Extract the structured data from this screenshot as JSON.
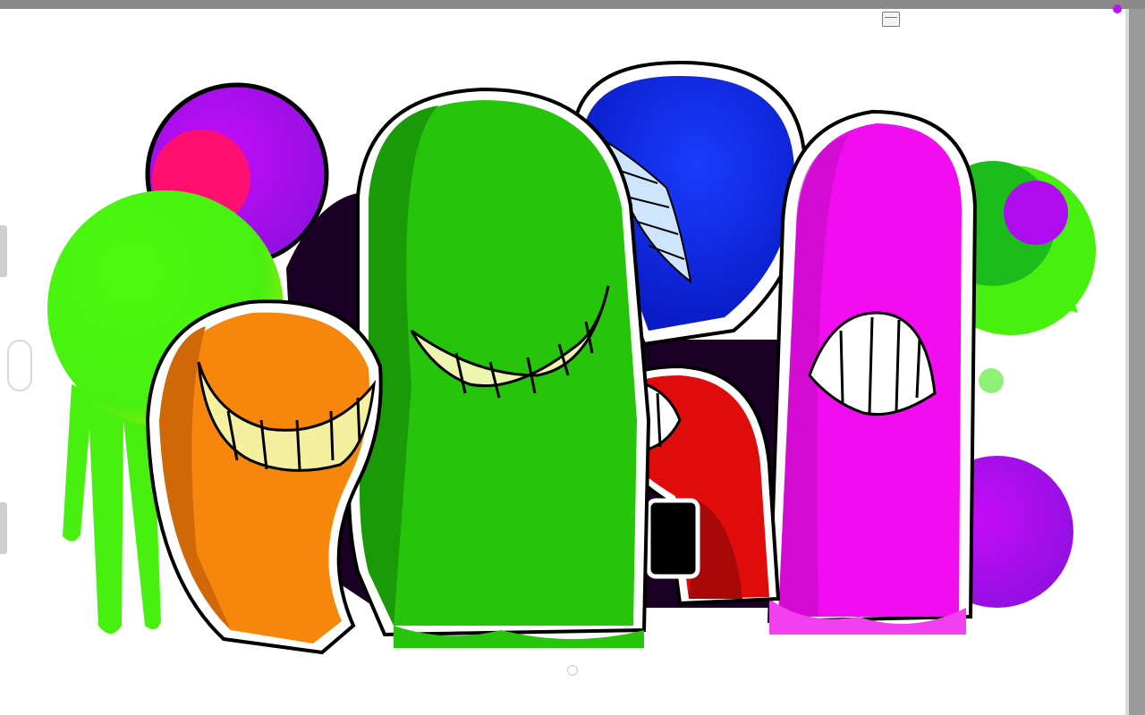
{
  "app": {
    "controls": {
      "fullscreen_icon": "fullscreen-toggle-icon",
      "home_icon": "home-indicator-icon",
      "side_handle_icon": "side-handle-icon"
    }
  },
  "artwork": {
    "colors": {
      "orange": "#f7870c",
      "green": "#27c40c",
      "blue": "#0c2ef0",
      "magenta": "#f20cf0",
      "red": "#e00c0c",
      "lime": "#48f010",
      "purple": "#b40cf0",
      "pink": "#ff1070",
      "teeth": "#eef5b0",
      "outline": "#000000"
    }
  }
}
